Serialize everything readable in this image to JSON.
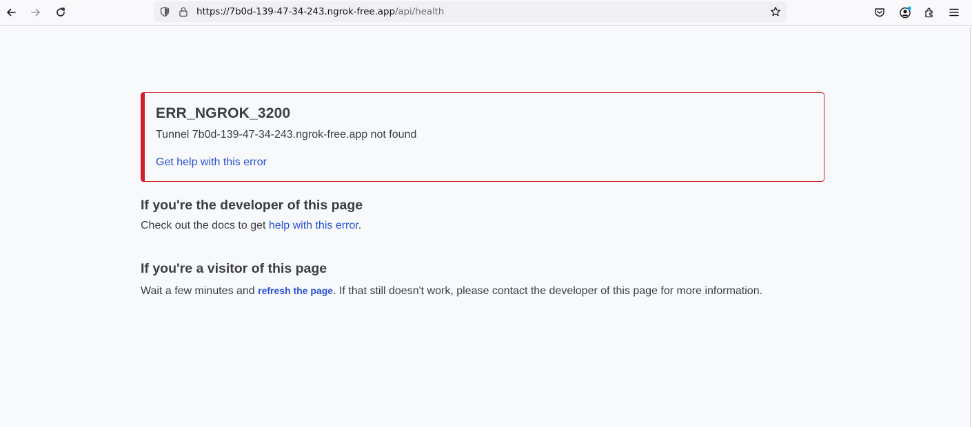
{
  "browser": {
    "url_host": "https://7b0d-139-47-34-243.ngrok-free.app",
    "url_path": "/api/health",
    "icons": [
      "back-arrow-icon",
      "forward-arrow-icon",
      "reload-icon",
      "shield-icon",
      "lock-icon",
      "bookmark-star-icon",
      "pocket-icon",
      "account-icon",
      "extensions-icon",
      "menu-icon"
    ]
  },
  "error": {
    "code": "ERR_NGROK_3200",
    "message": "Tunnel 7b0d-139-47-34-243.ngrok-free.app not found",
    "help_link": "Get help with this error",
    "accent_color": "#cf2027"
  },
  "developer_section": {
    "heading": "If you're the developer of this page",
    "text_before": "Check out the docs to get ",
    "link": "help with this error",
    "text_after": "."
  },
  "visitor_section": {
    "heading": "If you're a visitor of this page",
    "text_before": "Wait a few minutes and ",
    "link": "refresh the page",
    "text_after": ". If that still doesn't work, please contact the developer of this page for more information."
  },
  "colors": {
    "link": "#2751d8",
    "text": "#3b3d45",
    "page_bg": "#f8f9fb"
  }
}
